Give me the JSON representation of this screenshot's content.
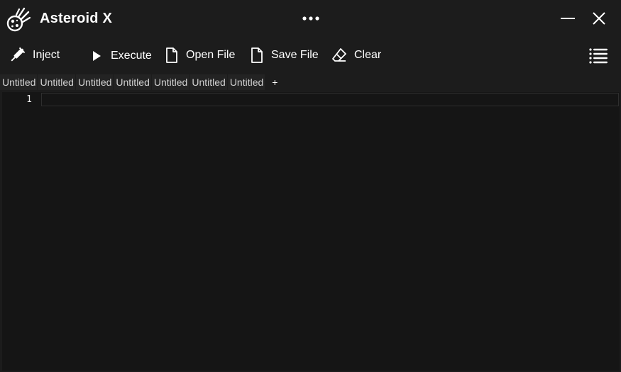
{
  "window": {
    "title": "Asteroid X",
    "logo_icon": "asteroid-logo-icon",
    "controls": [
      "more-icon",
      "minimize-icon",
      "close-icon"
    ]
  },
  "toolbar": {
    "inject_label": "Inject",
    "execute_label": "Execute",
    "open_label": "Open File",
    "save_label": "Save File",
    "clear_label": "Clear",
    "menu_icon": "list-menu-icon"
  },
  "tabs": [
    {
      "label": "Untitled"
    },
    {
      "label": "Untitled"
    },
    {
      "label": "Untitled"
    },
    {
      "label": "Untitled"
    },
    {
      "label": "Untitled"
    },
    {
      "label": "Untitled"
    },
    {
      "label": "Untitled"
    }
  ],
  "tab_add_label": "+",
  "editor": {
    "line_numbers": [
      "1"
    ],
    "content": ""
  },
  "colors": {
    "window_bg": "#1c1c1c",
    "editor_bg": "#151515",
    "text": "#ffffff"
  }
}
